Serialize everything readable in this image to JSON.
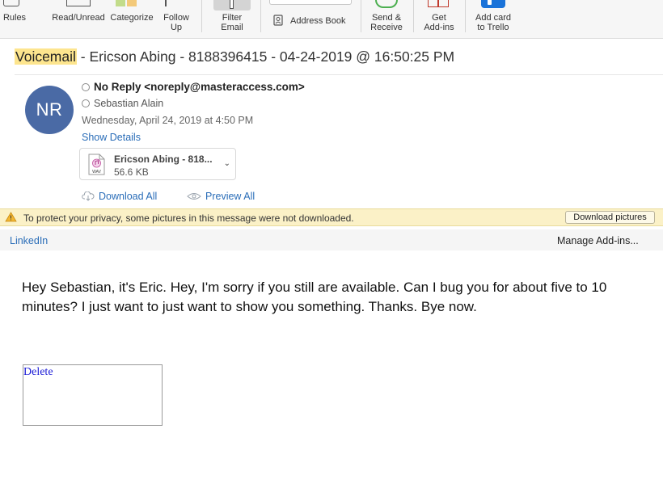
{
  "ribbon": {
    "rules": "Rules",
    "read_unread": "Read/Unread",
    "categorize": "Categorize",
    "follow_up_1": "Follow",
    "follow_up_2": "Up",
    "filter_email_1": "Filter",
    "filter_email_2": "Email",
    "address_book": "Address Book",
    "send_receive_1": "Send &",
    "send_receive_2": "Receive",
    "get_addins_1": "Get",
    "get_addins_2": "Add-ins",
    "trello_1": "Add card",
    "trello_2": "to Trello"
  },
  "message": {
    "subject_highlight": "Voicemail",
    "subject_rest": " - Ericson Abing - 8188396415 - 04-24-2019 @ 16:50:25 PM",
    "avatar_initials": "NR",
    "from": "No Reply <noreply@masteraccess.com>",
    "to": "Sebastian Alain",
    "date": "Wednesday, April 24, 2019 at 4:50 PM",
    "show_details": "Show Details",
    "attachment": {
      "name": "Ericson Abing - 818...",
      "size": "56.6 KB",
      "type_label": "WAV"
    },
    "download_all": "Download All",
    "preview_all": "Preview All"
  },
  "privacy_bar": {
    "text": "To protect your privacy, some pictures in this message were not downloaded.",
    "button": "Download pictures"
  },
  "addin_bar": {
    "linkedin": "LinkedIn",
    "manage": "Manage Add-ins..."
  },
  "body": {
    "text": "Hey Sebastian, it's Eric. Hey, I'm sorry if you still are available. Can I bug you for about five to 10 minutes? I just want to just want to show you something. Thanks. Bye now.",
    "delete_link": "Delete"
  },
  "colors": {
    "avatar": "#4a6aa5",
    "link": "#2a6db8",
    "subject_highlight": "#fde58e",
    "privacy_bar": "#fbf1c7"
  }
}
